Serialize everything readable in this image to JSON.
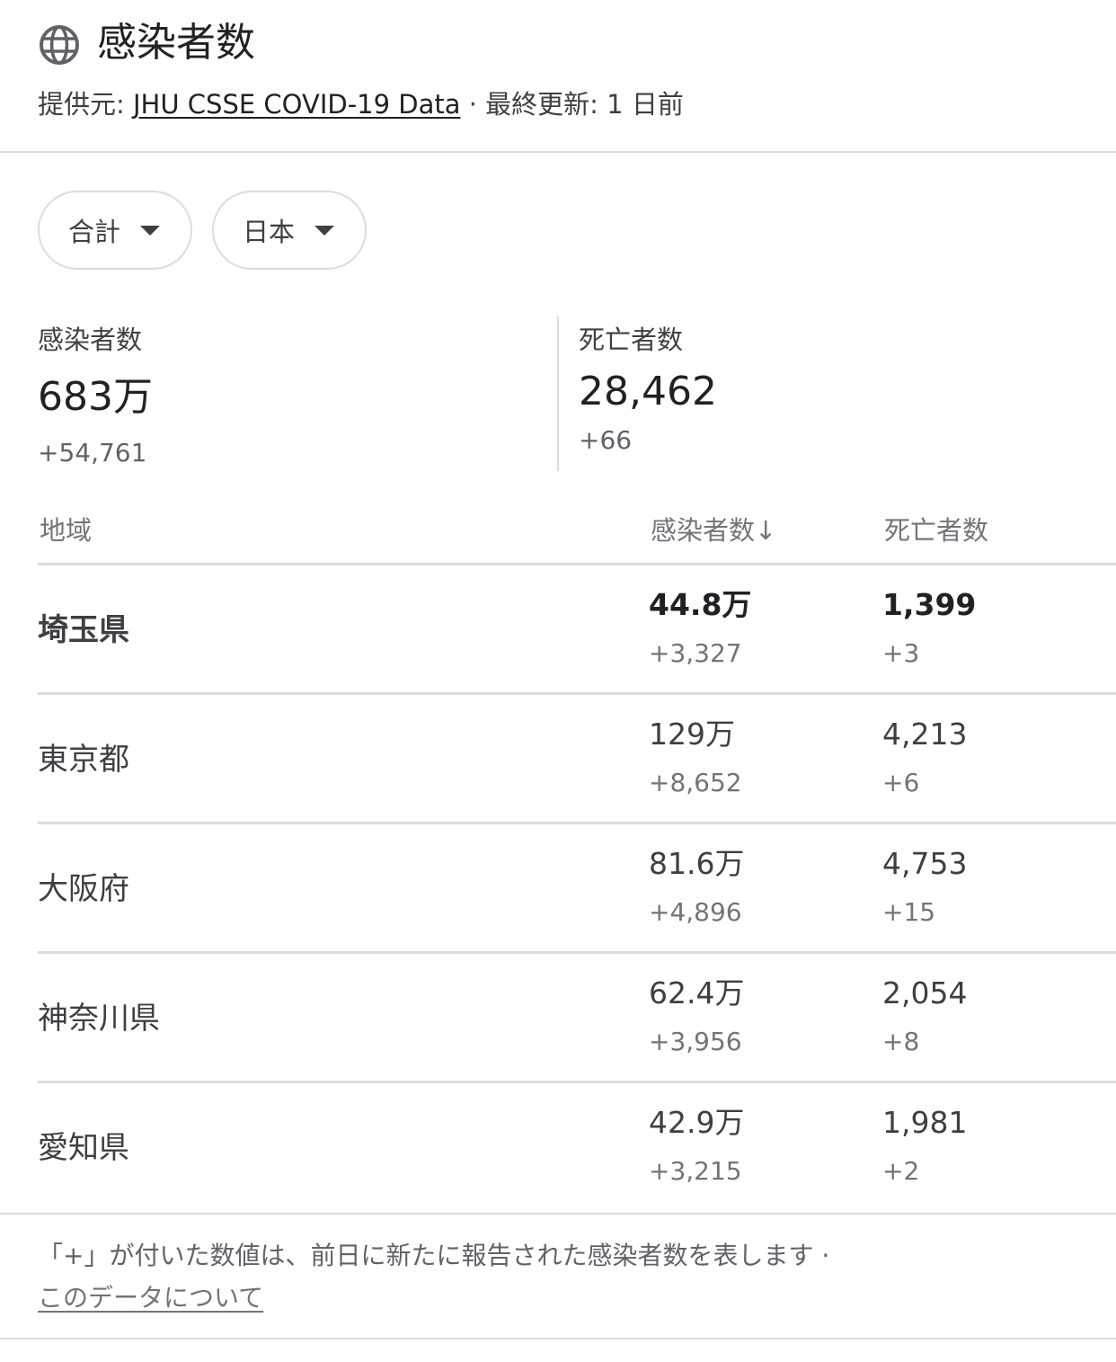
{
  "header": {
    "title": "感染者数",
    "source_prefix": "提供元: ",
    "source_link": "JHU CSSE COVID-19 Data",
    "updated": " · 最終更新: 1 日前"
  },
  "filters": {
    "scope": "合計",
    "country": "日本"
  },
  "summary": {
    "cases_label": "感染者数",
    "cases_value": "683万",
    "cases_delta": "+54,761",
    "deaths_label": "死亡者数",
    "deaths_value": "28,462",
    "deaths_delta": "+66"
  },
  "table": {
    "headers": {
      "region": "地域",
      "cases": "感染者数",
      "cases_sort_icon": "↓",
      "deaths": "死亡者数"
    },
    "rows": [
      {
        "region": "埼玉県",
        "cases": "44.8万",
        "cases_delta": "+3,327",
        "deaths": "1,399",
        "deaths_delta": "+3"
      },
      {
        "region": "東京都",
        "cases": "129万",
        "cases_delta": "+8,652",
        "deaths": "4,213",
        "deaths_delta": "+6"
      },
      {
        "region": "大阪府",
        "cases": "81.6万",
        "cases_delta": "+4,896",
        "deaths": "4,753",
        "deaths_delta": "+15"
      },
      {
        "region": "神奈川県",
        "cases": "62.4万",
        "cases_delta": "+3,956",
        "deaths": "2,054",
        "deaths_delta": "+8"
      },
      {
        "region": "愛知県",
        "cases": "42.9万",
        "cases_delta": "+3,215",
        "deaths": "1,981",
        "deaths_delta": "+2"
      }
    ]
  },
  "footer": {
    "note": "「+」が付いた数値は、前日に新たに報告された感染者数を表します ·",
    "link": "このデータについて"
  },
  "icons": {
    "header_icon": "globe-icon",
    "dropdown_icon": "caret-down-icon",
    "sort_icon": "arrow-down-icon"
  }
}
